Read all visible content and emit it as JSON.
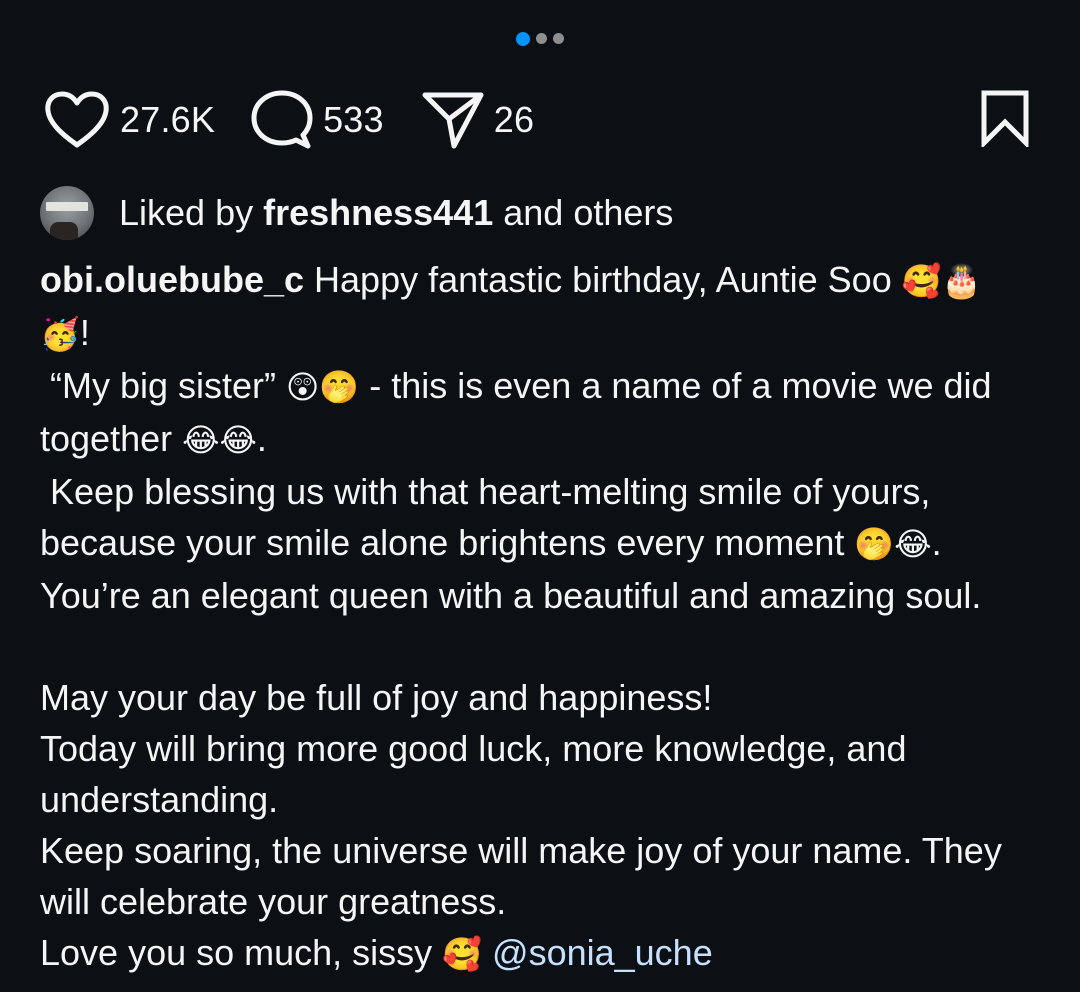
{
  "carousel": {
    "total": 3,
    "active": 0
  },
  "actions": {
    "likes": "27.6K",
    "comments": "533",
    "shares": "26"
  },
  "liked_by": {
    "prefix": "Liked by ",
    "user": "freshness441",
    "suffix": " and others"
  },
  "caption": {
    "username": "obi.oluebube_c",
    "line1": " Happy fantastic birthday, Auntie Soo ",
    "line1_emoji": "🥰🎂",
    "line2_emoji": "🥳",
    "line2_text": "!",
    "line3_text": " “My big sister” ",
    "line3_emoji": "😲🤭",
    "line3_rest": " - this is even a name of a movie we did together ",
    "line3_emoji2": "😂😂",
    "line3_end": ".",
    "line4_text": " Keep blessing us with that heart-melting smile of yours, because your smile alone brightens every moment ",
    "line4_emoji": "🤭😂",
    "line4_end": ".",
    "line5": "You’re an elegant queen with a beautiful and amazing soul.",
    "line6": "May your day be full of joy and happiness!",
    "line7": "Today will bring more good luck, more knowledge, and understanding.",
    "line8": "Keep soaring, the universe will make joy of your name. They will celebrate your greatness.",
    "line9_text": "Love you so much, sissy ",
    "line9_emoji": "🥰",
    "mention": " @sonia_uche"
  },
  "icons": {
    "like": "heart-icon",
    "comment": "comment-bubble-icon",
    "share": "send-paper-plane-icon",
    "save": "bookmark-icon"
  },
  "colors": {
    "background": "#0c1014",
    "text": "#f5f5f5",
    "dot_active": "#0095f6",
    "dot_inactive": "#8e8e8e",
    "mention": "#c6e0ff"
  }
}
